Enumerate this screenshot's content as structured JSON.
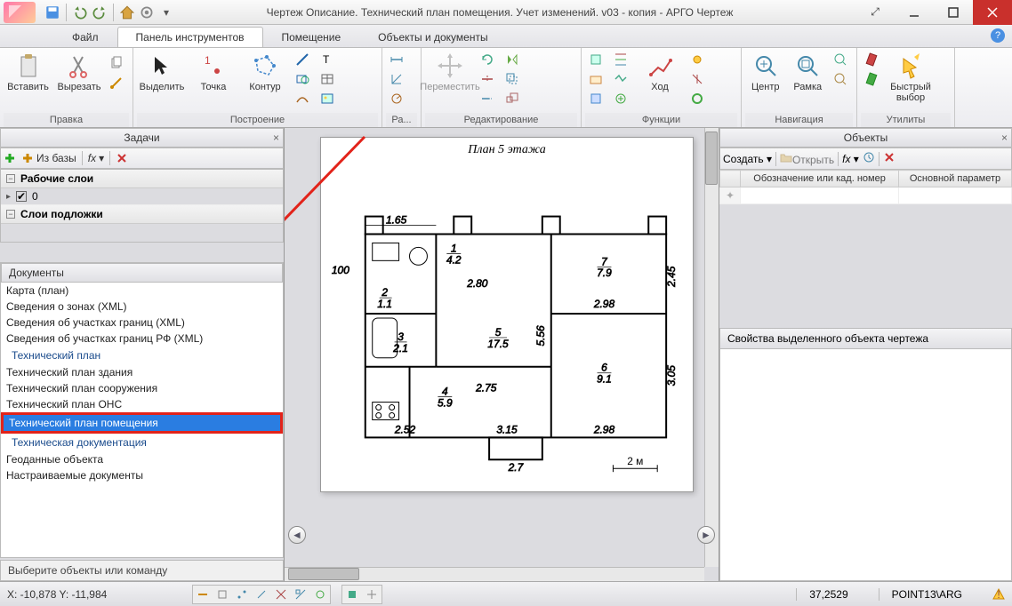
{
  "window": {
    "title": "Чертеж Описание. Технический план помещения. Учет изменений. v03 - копия - АРГО Чертеж"
  },
  "tabs": {
    "file": "Файл",
    "tools": "Панель инструментов",
    "room": "Помещение",
    "objects": "Объекты и документы"
  },
  "ribbon": {
    "edit_group": "Правка",
    "paste": "Вставить",
    "cut": "Вырезать",
    "build_group": "Построение",
    "select": "Выделить",
    "point": "Точка",
    "contour": "Контур",
    "raz_group": "Ра...",
    "editing_group": "Редактирование",
    "move": "Переместить",
    "funcs_group": "Функции",
    "go": "Ход",
    "nav_group": "Навигация",
    "center": "Центр",
    "frame": "Рамка",
    "util_group": "Утилиты",
    "quick": "Быстрый выбор"
  },
  "tasks": {
    "header": "Задачи",
    "from_db": "Из базы",
    "fx": "fx",
    "work_layers": "Рабочие слои",
    "layer0": "0",
    "substrate_layers": "Слои подложки"
  },
  "docs": {
    "header": "Документы",
    "items": [
      {
        "t": "item",
        "label": "Карта (план)"
      },
      {
        "t": "item",
        "label": "Сведения о зонах (XML)"
      },
      {
        "t": "item",
        "label": "Сведения об участках границ (XML)"
      },
      {
        "t": "item",
        "label": "Сведения об участках границ РФ (XML)"
      },
      {
        "t": "group",
        "label": "Технический план"
      },
      {
        "t": "item",
        "label": "Технический план здания"
      },
      {
        "t": "item",
        "label": "Технический план сооружения"
      },
      {
        "t": "item",
        "label": "Технический план ОНС"
      },
      {
        "t": "sel",
        "label": "Технический план помещения"
      },
      {
        "t": "group",
        "label": "Техническая документация"
      },
      {
        "t": "item",
        "label": "Геоданные объекта"
      },
      {
        "t": "item",
        "label": "Настраиваемые документы"
      }
    ]
  },
  "drawing": {
    "title": "План 5 этажа",
    "scale_label": "2 м",
    "dims": {
      "d100": "100",
      "d165": "1.65",
      "r1_42": "1",
      "r1_42b": "4.2",
      "d280": "2.80",
      "r7_79a": "7",
      "r7_79b": "7.9",
      "d245": "2.45",
      "d298": "2.98",
      "r2_11a": "2",
      "r2_11b": "1.1",
      "r3_21a": "3",
      "r3_21b": "2.1",
      "r5_175a": "5",
      "r5_175b": "17.5",
      "d556": "5.56",
      "r6_91a": "6",
      "r6_91b": "9.1",
      "d305": "3.05",
      "r4_59a": "4",
      "r4_59b": "5.9",
      "d275": "2.75",
      "d252": "2.52",
      "d315": "3.15",
      "d298b": "2.98",
      "d27": "2.7"
    }
  },
  "objects": {
    "header": "Объекты",
    "create": "Создать",
    "open": "Открыть",
    "fx": "fx",
    "col1": "Обозначение или кад. номер",
    "col2": "Основной параметр"
  },
  "props": {
    "header": "Свойства выделенного объекта чертежа"
  },
  "hint": "Выберите объекты или команду",
  "status": {
    "coords": "X: -10,878 Y: -11,984",
    "val": "37,2529",
    "mode": "POINT13\\ARG"
  }
}
